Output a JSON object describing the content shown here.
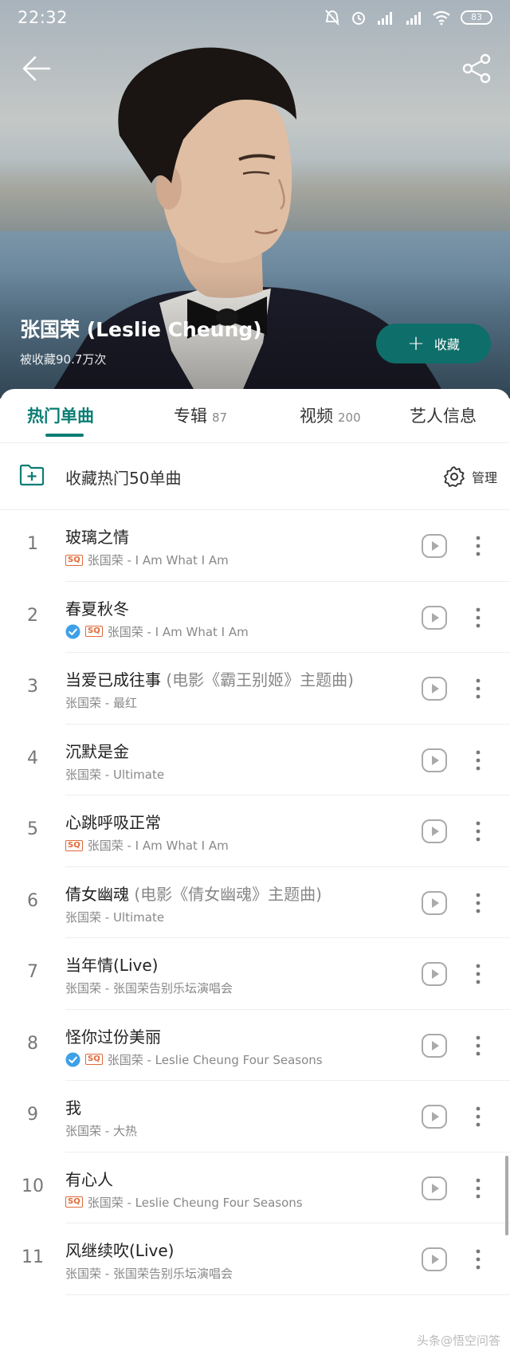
{
  "status_bar": {
    "time": "22:32",
    "battery": "83"
  },
  "artist": {
    "name": "张国荣 (Leslie Cheung)",
    "fav_count": "被收藏90.7万次",
    "fav_button_label": "收藏"
  },
  "tabs": [
    {
      "label": "热门单曲",
      "count": ""
    },
    {
      "label": "专辑",
      "count": "87"
    },
    {
      "label": "视频",
      "count": "200"
    },
    {
      "label": "艺人信息",
      "count": ""
    }
  ],
  "collect": {
    "label": "收藏热门50单曲",
    "manage_label": "管理"
  },
  "songs": [
    {
      "num": "1",
      "title": "玻璃之情",
      "subtitle": "",
      "sq": true,
      "verified": false,
      "meta": "张国荣 - I Am What I Am"
    },
    {
      "num": "2",
      "title": "春夏秋冬",
      "subtitle": "",
      "sq": true,
      "verified": true,
      "meta": "张国荣 - I Am What I Am"
    },
    {
      "num": "3",
      "title": "当爱已成往事",
      "subtitle": "(电影《霸王别姬》主题曲)",
      "sq": false,
      "verified": false,
      "meta": "张国荣 - 最红"
    },
    {
      "num": "4",
      "title": "沉默是金",
      "subtitle": "",
      "sq": false,
      "verified": false,
      "meta": "张国荣 - Ultimate"
    },
    {
      "num": "5",
      "title": "心跳呼吸正常",
      "subtitle": "",
      "sq": true,
      "verified": false,
      "meta": "张国荣 - I Am What I Am"
    },
    {
      "num": "6",
      "title": "倩女幽魂",
      "subtitle": "(电影《倩女幽魂》主题曲)",
      "sq": false,
      "verified": false,
      "meta": "张国荣 - Ultimate"
    },
    {
      "num": "7",
      "title": "当年情(Live)",
      "subtitle": "",
      "sq": false,
      "verified": false,
      "meta": "张国荣 - 张国荣告别乐坛演唱会"
    },
    {
      "num": "8",
      "title": "怪你过份美丽",
      "subtitle": "",
      "sq": true,
      "verified": true,
      "meta": "张国荣 - Leslie Cheung Four Seasons"
    },
    {
      "num": "9",
      "title": "我",
      "subtitle": "",
      "sq": false,
      "verified": false,
      "meta": "张国荣 - 大热"
    },
    {
      "num": "10",
      "title": "有心人",
      "subtitle": "",
      "sq": true,
      "verified": false,
      "meta": "张国荣 - Leslie Cheung Four Seasons"
    },
    {
      "num": "11",
      "title": "风继续吹(Live)",
      "subtitle": "",
      "sq": false,
      "verified": false,
      "meta": "张国荣 - 张国荣告别乐坛演唱会"
    }
  ],
  "badges": {
    "sq": "SQ"
  },
  "colors": {
    "accent": "#0b7d74",
    "fav_button": "#0e6e6a",
    "sq_badge": "#e06a3a",
    "verified": "#3ea0e8"
  },
  "watermark": "头条@悟空问答"
}
